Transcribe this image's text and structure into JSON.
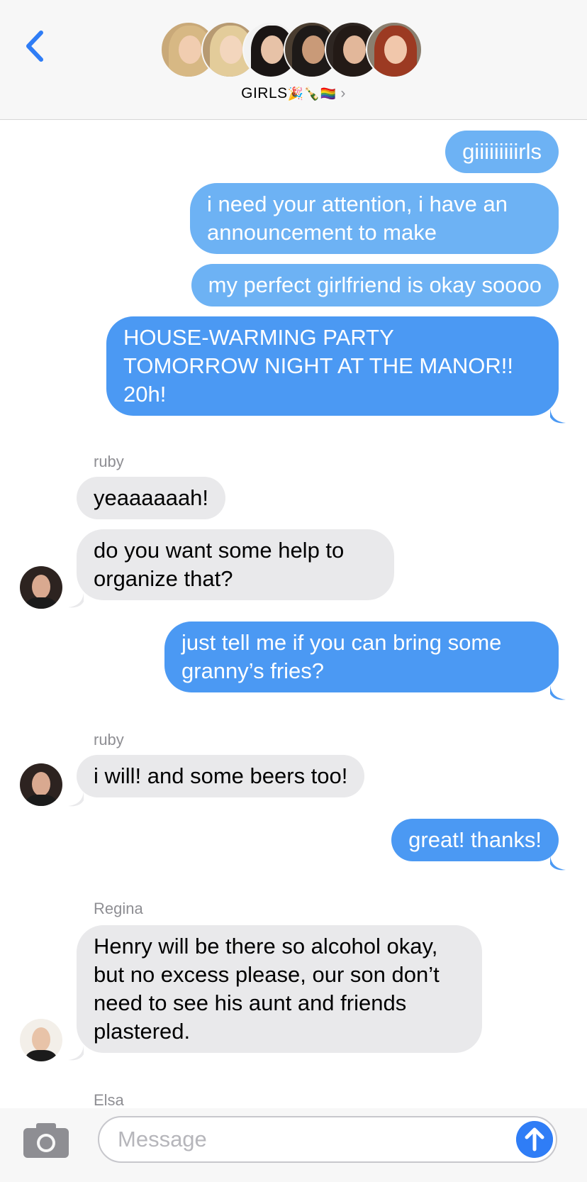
{
  "header": {
    "group_name": "GIRLS",
    "group_emojis": "🎉🍾🏳️‍🌈",
    "chevron": "›",
    "participants": [
      {
        "hair": "#d7b884",
        "face": "#f1cdb0",
        "bg": "#c9a979"
      },
      {
        "hair": "#e3cc9a",
        "face": "#f3d6bd",
        "bg": "#b79a72"
      },
      {
        "hair": "#1a1514",
        "face": "#e7c2a7",
        "bg": "#f2f2f2"
      },
      {
        "hair": "#1e1a18",
        "face": "#c99a78",
        "bg": "#4a3d30"
      },
      {
        "hair": "#231a16",
        "face": "#e2b79a",
        "bg": "#2e2622"
      },
      {
        "hair": "#9c3a22",
        "face": "#f1c7ab",
        "bg": "#8a7f6f"
      }
    ]
  },
  "messages": {
    "m1": "giiiiiiiiirls",
    "m2": "i need your attention, i have an announcement to make",
    "m3": "my perfect girlfriend is okay soooo",
    "m4_line1": "HOUSE-WARMING PARTY",
    "m4_line2": "TOMORROW NIGHT AT THE MANOR!!",
    "m4_line3": "20h!",
    "sender1": "ruby",
    "m5": "yeaaaaaah!",
    "m6": "do you want some help to organize that?",
    "m7": "just tell me if you can bring some granny’s fries?",
    "sender2": "ruby",
    "m8": "i will! and some beers too!",
    "m9": "great! thanks!",
    "sender3": "Regina",
    "m10": "Henry will be there so alcohol okay, but no excess please, our son don’t need to see his aunt and friends plastered.",
    "sender4": "Elsa"
  },
  "input": {
    "placeholder": "Message"
  },
  "colors": {
    "outgoing": "#4b99f3",
    "outgoing_light": "#6db2f4",
    "incoming": "#e9e9eb",
    "accent": "#2f7df6"
  }
}
